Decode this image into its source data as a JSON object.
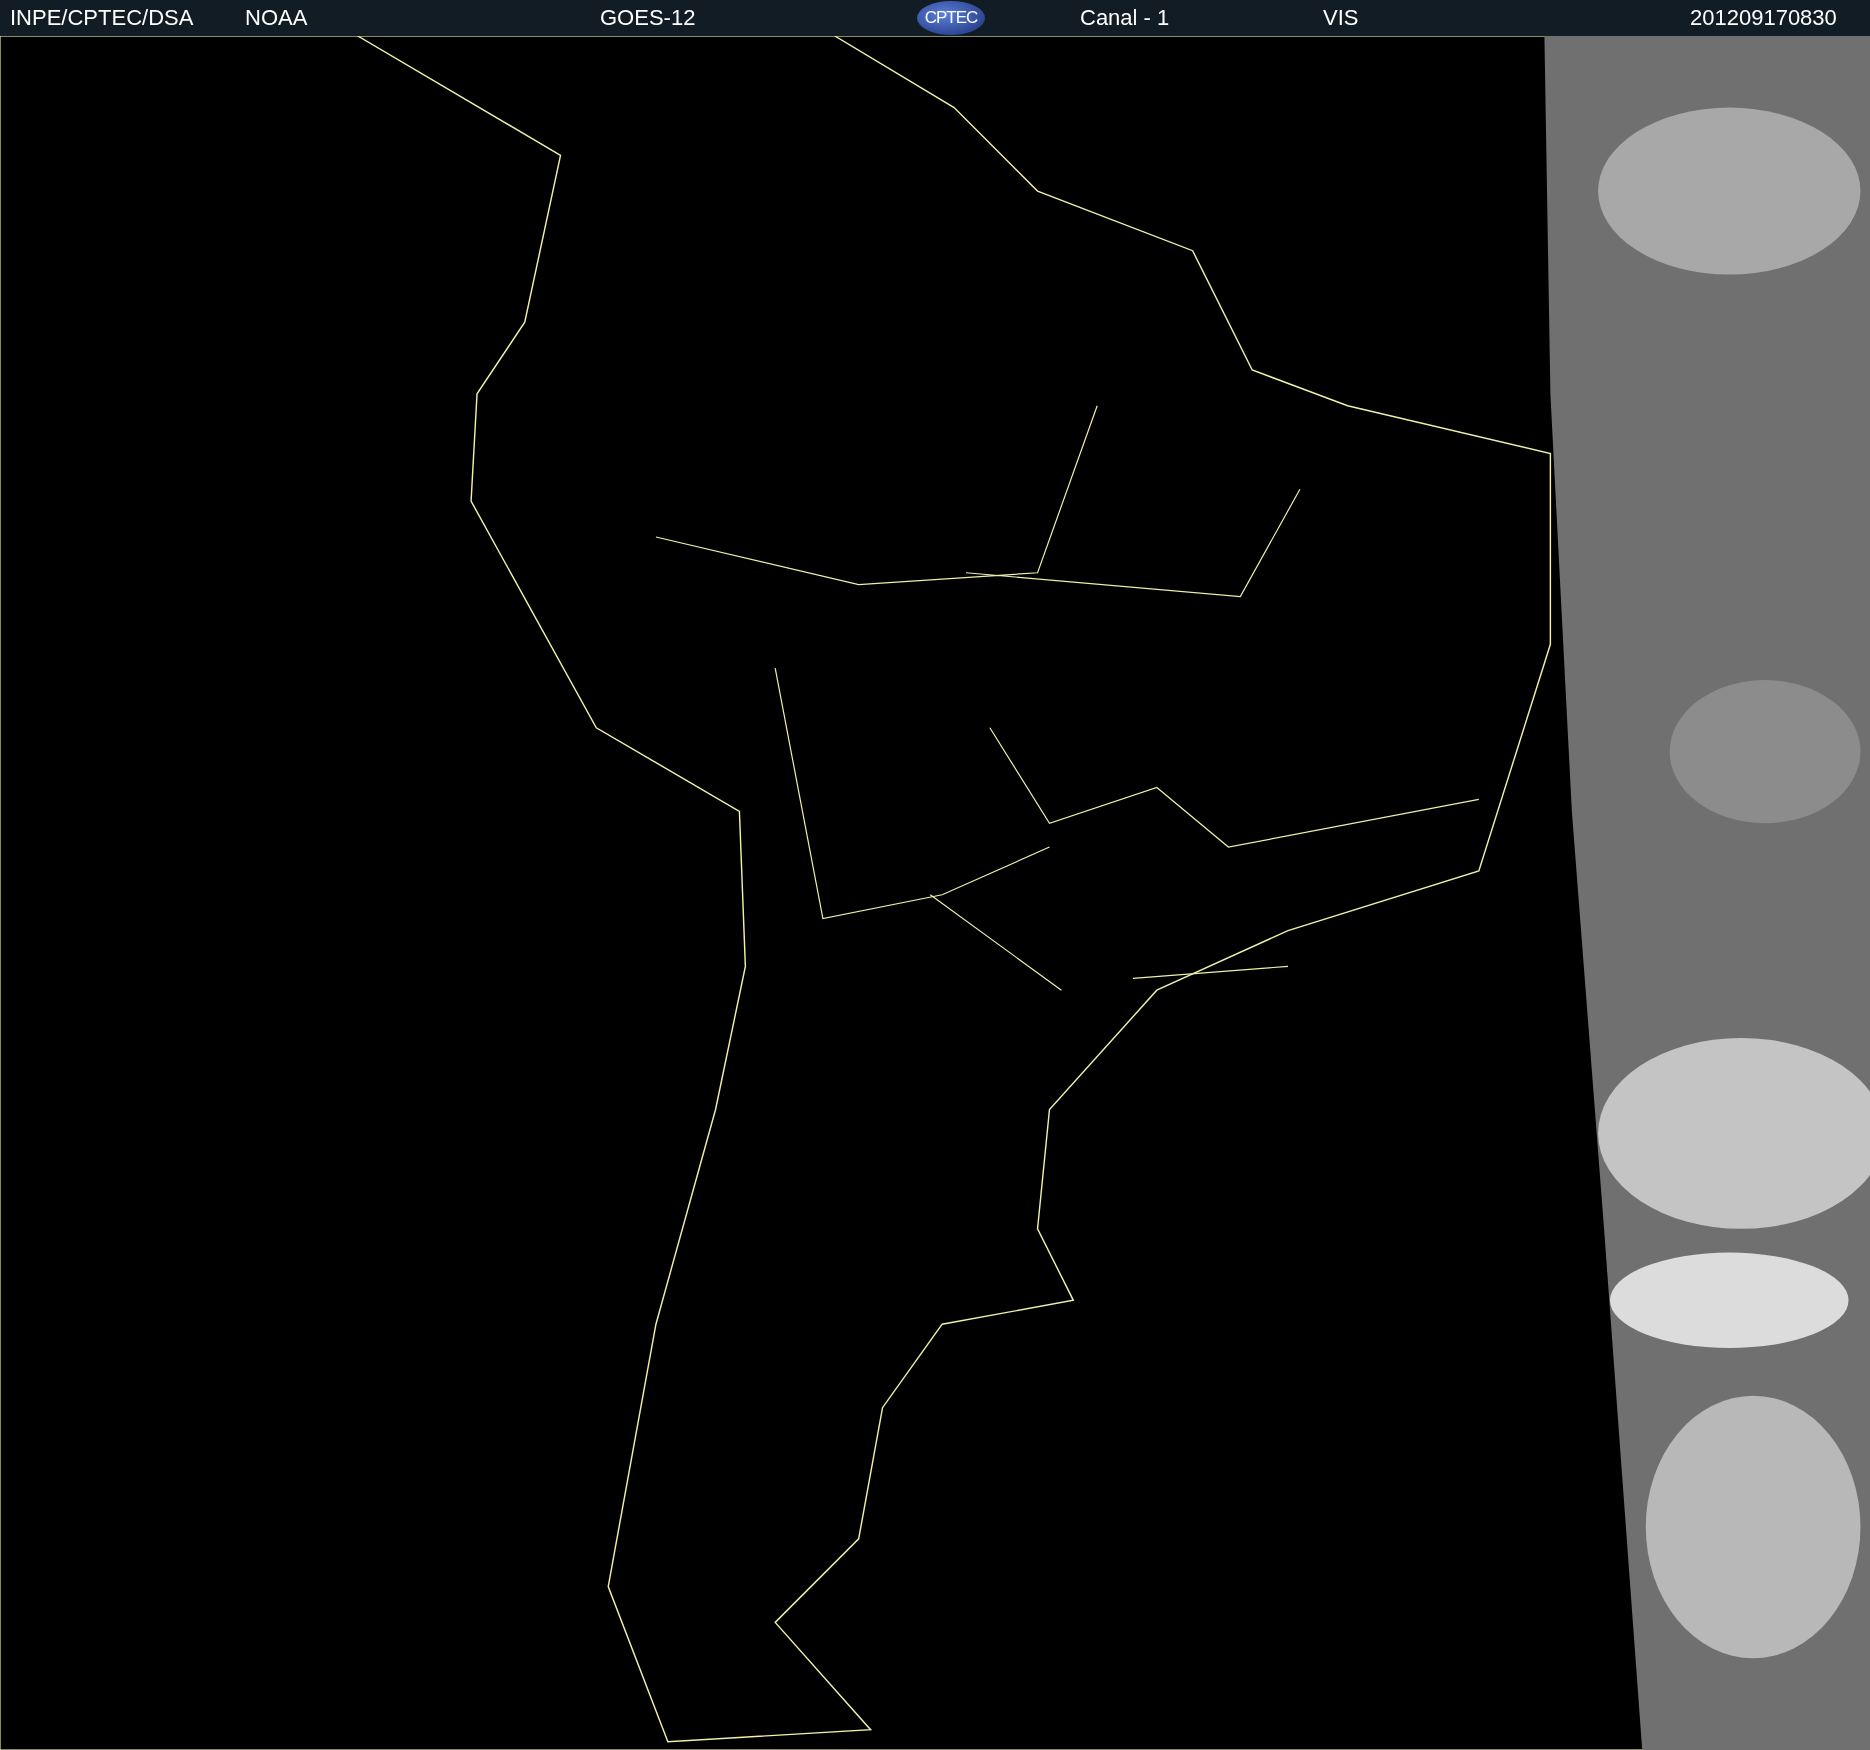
{
  "header": {
    "source": "INPE/CPTEC/DSA",
    "agency": "NOAA",
    "satellite": "GOES-12",
    "logo": "CPTEC",
    "channel": "Canal - 1",
    "band": "VIS",
    "timestamp": "201209170830"
  }
}
